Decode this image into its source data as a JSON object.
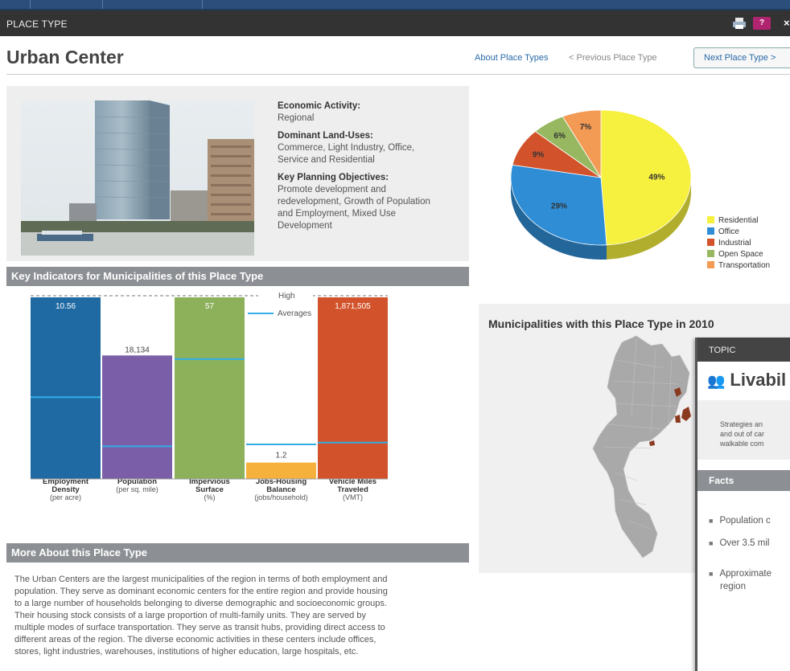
{
  "window": {
    "title": "PLACE TYPE",
    "help_label": "?",
    "close_label": "×"
  },
  "header": {
    "title": "Urban Center",
    "about_link": "About Place Types",
    "prev_link": "< Previous Place Type",
    "next_button": "Next Place Type >"
  },
  "info": {
    "economic_activity_label": "Economic Activity:",
    "economic_activity": "Regional",
    "land_uses_label": "Dominant Land-Uses:",
    "land_uses_1": "Commerce, Light Industry, Office,",
    "land_uses_2": "Service and Residential",
    "objectives_label": "Key Planning Objectives:",
    "objectives_1": "Promote development and",
    "objectives_2": "redevelopment, Growth of Population",
    "objectives_3": "and Employment, Mixed Use",
    "objectives_4": "Development"
  },
  "indicators": {
    "heading": "Key Indicators for Municipalities of this Place Type",
    "high_label": "High",
    "averages_label": "Averages",
    "bars": [
      {
        "label": "10.56",
        "name": "Employment",
        "name2": "Density",
        "unit": "(per acre)",
        "color": "#1f6aa3",
        "fill": 1.0,
        "avg": 0.45
      },
      {
        "label": "18,134",
        "name": "Population",
        "name2": "",
        "unit": "(per sq. mile)",
        "color": "#7b5ea8",
        "fill": 0.68,
        "avg": 0.18
      },
      {
        "label": "57",
        "name": "Impervious",
        "name2": "Surface",
        "unit": "(%)",
        "color": "#8db05a",
        "fill": 1.0,
        "avg": 0.66
      },
      {
        "label": "1.2",
        "name": "Jobs-Housing",
        "name2": "Balance",
        "unit": "(jobs/household)",
        "color": "#f6b03c",
        "fill": 0.09,
        "avg": 0.19
      },
      {
        "label": "1,871,505",
        "name": "Vehicle Miles",
        "name2": "Traveled",
        "unit": "(VMT)",
        "color": "#d2532b",
        "fill": 1.0,
        "avg": 0.2
      }
    ]
  },
  "more": {
    "heading": "More About this Place Type",
    "lines": [
      "The Urban Centers are the largest municipalities of the region in terms of both employment and",
      "population. They serve as dominant economic centers for the entire region and provide housing",
      "to a large number of households belonging to diverse demographic and socioeconomic groups.",
      "Their housing stock consists of a large proportion of multi-family units. They are served by",
      "multiple modes of surface transportation. They serve as transit hubs, providing direct access to",
      "different areas of the region. The diverse economic activities in these centers include offices,",
      "stores, light industries, warehouses, institutions of higher education, large hospitals, etc."
    ]
  },
  "chart_data": {
    "type": "pie",
    "categories": [
      "Residential",
      "Office",
      "Industrial",
      "Open Space",
      "Transportation"
    ],
    "values": [
      49,
      29,
      9,
      6,
      7
    ],
    "labels": [
      "49%",
      "29%",
      "9%",
      "6%",
      "7%"
    ],
    "colors": [
      "#f6f03e",
      "#2f8dd6",
      "#d2532b",
      "#97b860",
      "#f39a54"
    ],
    "legend": "right"
  },
  "map": {
    "title": "Municipalities with this Place Type in 2010"
  },
  "topic": {
    "bar_label": "TOPIC",
    "title": "Livabil",
    "desc_1": "Strategies an",
    "desc_2": "and out of car",
    "desc_3": "walkable com",
    "facts_label": "Facts",
    "fact_1": "Population c",
    "fact_2": "Over 3.5 mil",
    "fact_3": "Approximate",
    "fact_3b": "region"
  }
}
